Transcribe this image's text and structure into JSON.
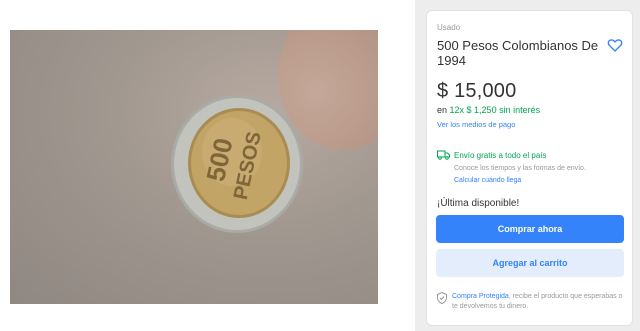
{
  "product": {
    "condition": "Usado",
    "title": "500 Pesos Colombianos De 1994",
    "price": "$ 15,000",
    "installments_prefix": "en",
    "installments_offer": "12x $ 1,250 sin interés",
    "payment_methods_link": "Ver los medios de pago",
    "photo": {
      "coin_text_line1": "500",
      "coin_text_line2": "PESOS"
    }
  },
  "shipping": {
    "title": "Envío gratis a todo el país",
    "subtitle": "Conoce los tiempos y las formas de envío.",
    "link": "Calcular cuándo llega"
  },
  "stock": {
    "label": "¡Última disponible!"
  },
  "actions": {
    "buy_now": "Comprar ahora",
    "add_to_cart": "Agregar al carrito"
  },
  "protection": {
    "link": "Compra Protegida",
    "text": ", recibe el producto que esperabas o te devolvemos tu dinero."
  },
  "icons": {
    "favorite": "heart-icon",
    "shipping": "truck-icon",
    "protection": "shield-icon"
  },
  "colors": {
    "accent": "#3483fa",
    "success": "#00a650",
    "muted": "#999999"
  }
}
